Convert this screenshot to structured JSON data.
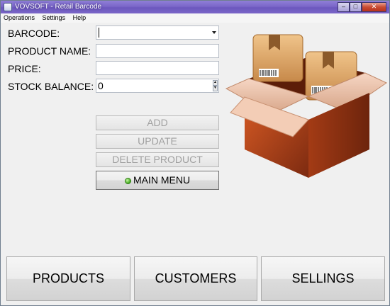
{
  "window": {
    "title": "VOVSOFT - Retail Barcode"
  },
  "menu": [
    "Operations",
    "Settings",
    "Help"
  ],
  "form": {
    "barcode": {
      "label": "BARCODE:",
      "value": ""
    },
    "product_name": {
      "label": "PRODUCT NAME:",
      "value": ""
    },
    "price": {
      "label": "PRICE:",
      "value": ""
    },
    "stock_balance": {
      "label": "STOCK BALANCE:",
      "value": "0"
    }
  },
  "actions": {
    "add": "ADD",
    "update": "UPDATE",
    "delete": "DELETE PRODUCT",
    "main_menu": "MAIN MENU"
  },
  "nav": {
    "products": "PRODUCTS",
    "customers": "CUSTOMERS",
    "sellings": "SELLINGS"
  },
  "art": {
    "icon": "box-of-barcoded-packages-icon"
  },
  "colors": {
    "titlebar": "#7b67c9",
    "box_brown": "#c24a1f",
    "disabled_text": "#a0a0a0"
  }
}
